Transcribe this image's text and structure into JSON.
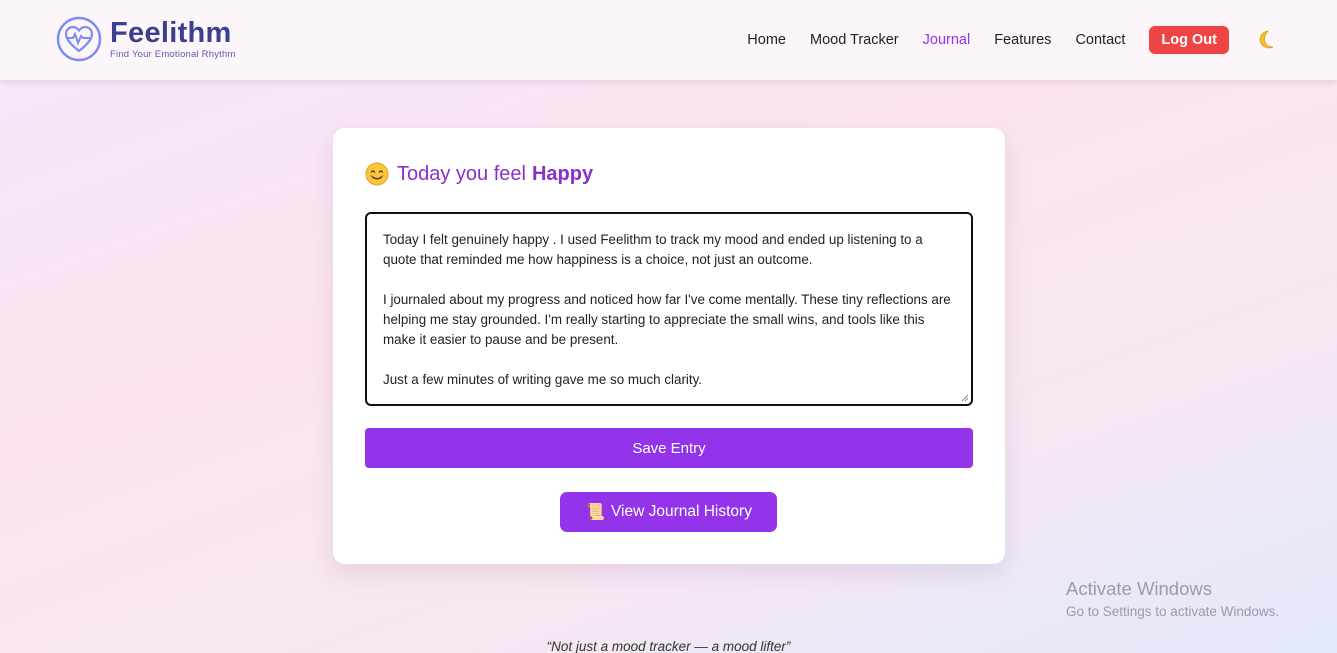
{
  "brand": {
    "name": "Feelithm",
    "tagline": "Find Your Emotional Rhythm",
    "logo_icon": "heart-pulse-icon",
    "color": "#3a3f8f"
  },
  "nav": {
    "links": [
      {
        "label": "Home",
        "active": false
      },
      {
        "label": "Mood Tracker",
        "active": false
      },
      {
        "label": "Journal",
        "active": true
      },
      {
        "label": "Features",
        "active": false
      },
      {
        "label": "Contact",
        "active": false
      }
    ],
    "logout_label": "Log Out",
    "theme_icon": "moon-icon",
    "accent": "#9333ea",
    "logout_color": "#ef4444"
  },
  "journal": {
    "heading_prefix": "Today you feel",
    "mood": "Happy",
    "mood_icon": "smiling-face-icon",
    "entry": {
      "p1": "Today I felt genuinely happy . I used Feelithm to track my mood and ended up listening to a quote that reminded me how happiness is a choice, not just an outcome.",
      "p2": "I journaled about my progress and noticed how far I've come mentally. These tiny reflections are helping me stay grounded. I'm really starting to appreciate the small wins, and tools like this make it easier to pause and be present.",
      "p3": "Just a few minutes of writing gave me so much clarity."
    },
    "save_label": "Save Entry",
    "history_label": "View Journal History",
    "history_icon": "scroll-icon"
  },
  "watermark": {
    "title": "Activate Windows",
    "subtitle": "Go to Settings to activate Windows."
  },
  "footer": {
    "quote": "“Not just a mood tracker — a mood lifter”"
  }
}
